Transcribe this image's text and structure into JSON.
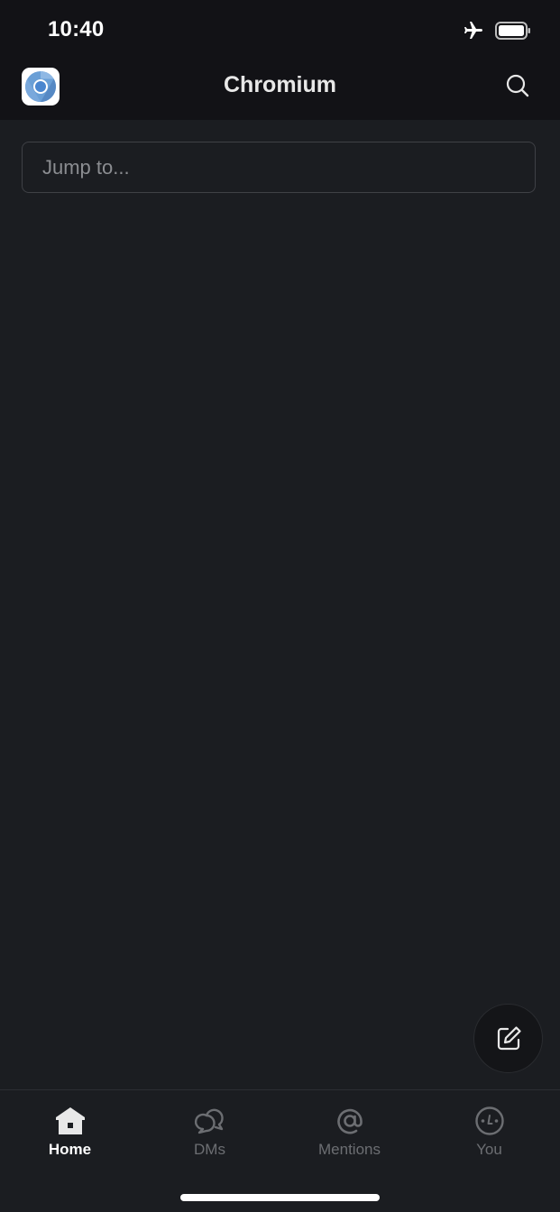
{
  "status_bar": {
    "time": "10:40",
    "icons": [
      "airplane-icon",
      "battery-icon"
    ]
  },
  "header": {
    "title": "Chromium",
    "workspace_icon": "chromium-logo",
    "search_icon": "search-icon"
  },
  "jump": {
    "value": "",
    "placeholder": "Jump to..."
  },
  "compose": {
    "icon": "compose-icon"
  },
  "tabs": [
    {
      "label": "Home",
      "icon": "home-icon",
      "active": true
    },
    {
      "label": "DMs",
      "icon": "dms-icon",
      "active": false
    },
    {
      "label": "Mentions",
      "icon": "mentions-icon",
      "active": false
    },
    {
      "label": "You",
      "icon": "you-icon",
      "active": false
    }
  ],
  "colors": {
    "background": "#1b1d21",
    "header_background": "#121216",
    "active_tab": "#ffffff",
    "inactive_tab": "#6c6e72"
  }
}
